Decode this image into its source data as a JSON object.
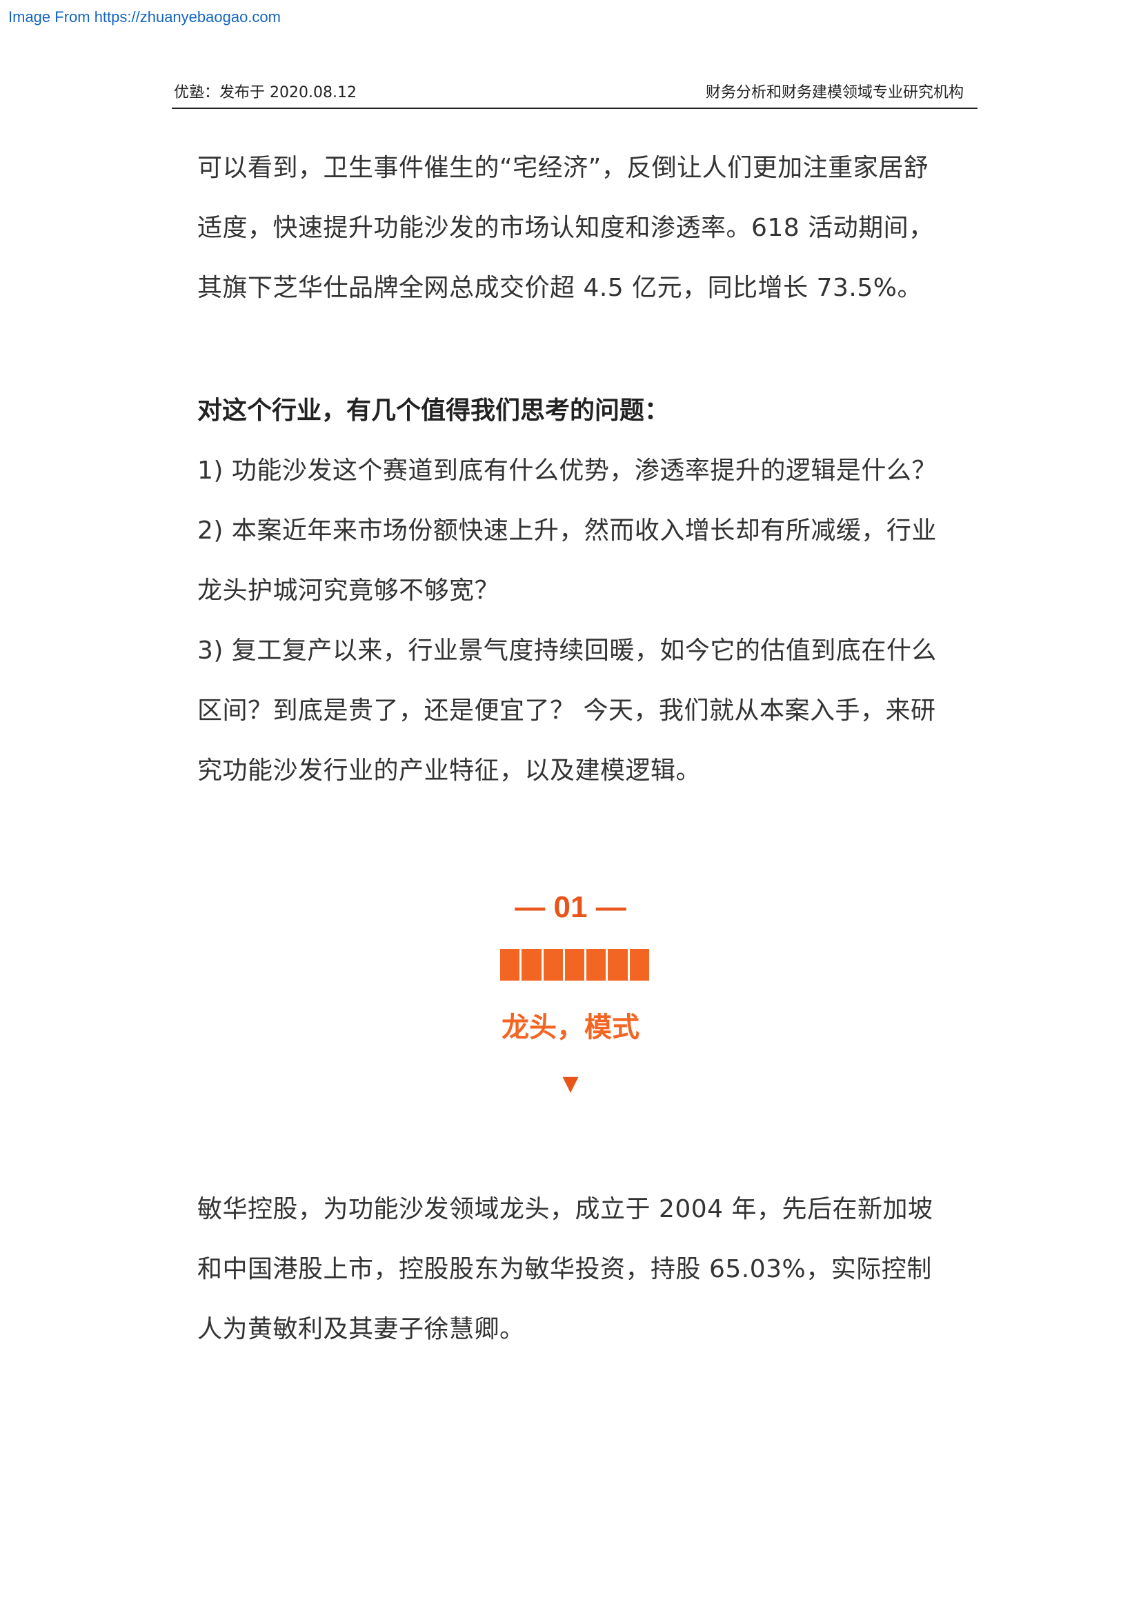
{
  "source_link": "Image From https://zhuanyebaogao.com",
  "header": {
    "left": "优塾：发布于 2020.08.12",
    "right": "财务分析和财务建模领域专业研究机构"
  },
  "paragraph1": [
    "可以看到，卫生事件催生的“宅经济”，反倒让人们更加注重家居舒",
    "适度，快速提升功能沙发的市场认知度和渗透率。618 活动期间，",
    "其旗下芝华仕品牌全网总成交价超 4.5 亿元，同比增长 73.5%。"
  ],
  "questions_heading": "对这个行业，有几个值得我们思考的问题：",
  "questions": [
    "1) 功能沙发这个赛道到底有什么优势，渗透率提升的逻辑是什么？",
    "2) 本案近年来市场份额快速上升，然而收入增长却有所减缓，行业",
    "龙头护城河究竟够不够宽？",
    "3) 复工复产以来，行业景气度持续回暖，如今它的估值到底在什么",
    "区间？到底是贵了，还是便宜了？  今天，我们就从本案入手，来研",
    "究功能沙发行业的产业特征，以及建模逻辑。"
  ],
  "section": {
    "number": "— 01 —",
    "title": "龙头，模式",
    "arrow": "▼",
    "accent_color": "#f26522"
  },
  "paragraph2": [
    "敏华控股，为功能沙发领域龙头，成立于 2004 年，先后在新加坡",
    "和中国港股上市，控股股东为敏华投资，持股 65.03%，实际控制",
    "人为黄敏利及其妻子徐慧卿。"
  ]
}
